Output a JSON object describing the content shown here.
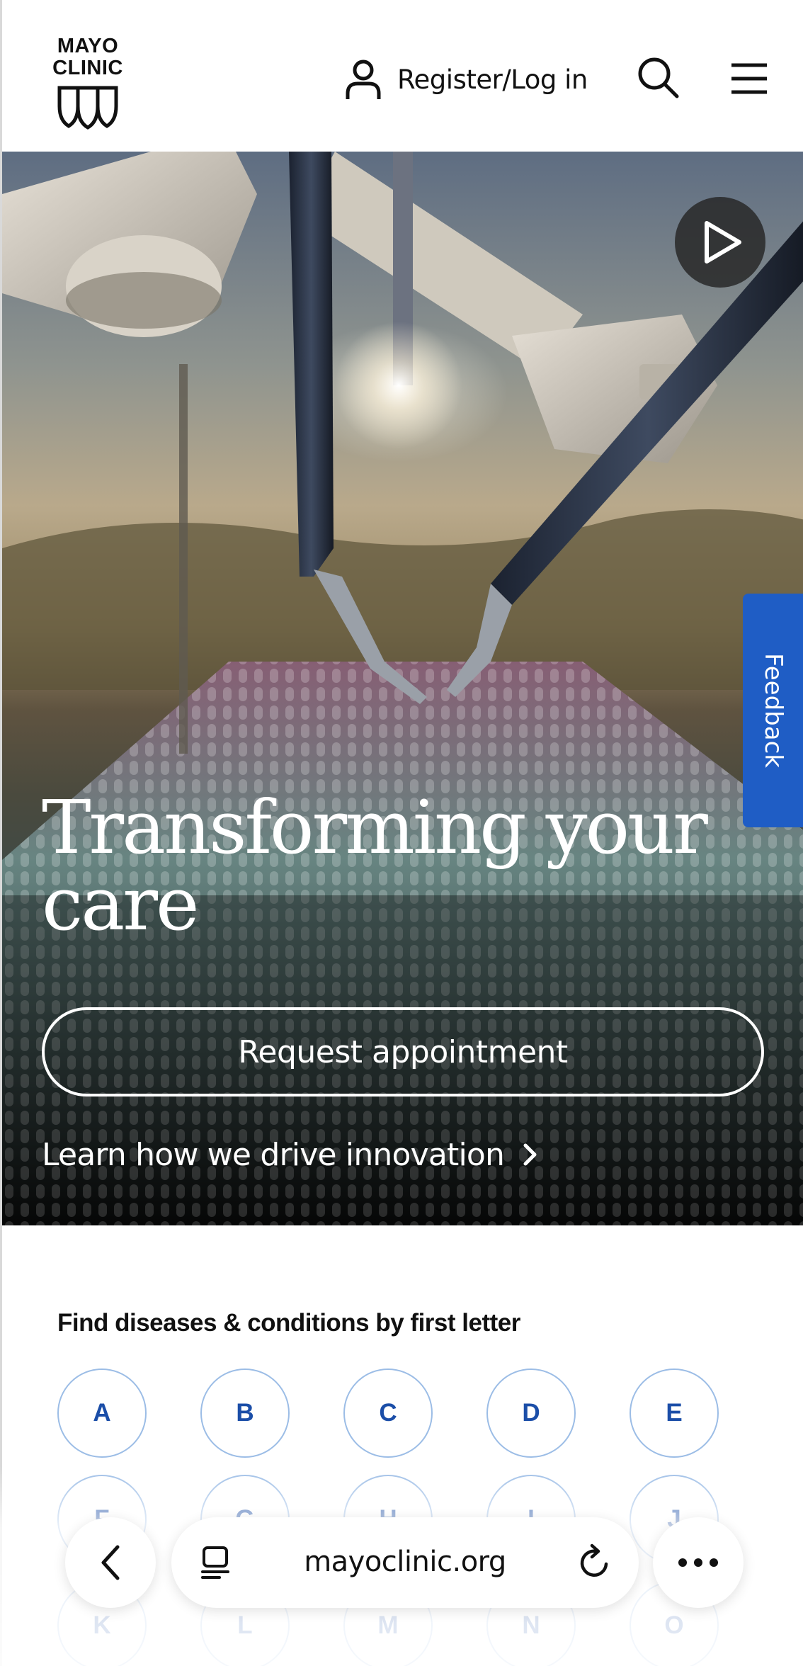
{
  "header": {
    "logo_line1": "MAYO",
    "logo_line2": "CLINIC",
    "login_label": "Register/Log in",
    "icons": [
      "user-icon",
      "search-icon",
      "menu-icon"
    ]
  },
  "hero": {
    "title": "Transforming your care",
    "cta_label": "Request appointment",
    "link_label": "Learn how we drive innovation",
    "icons": [
      "play-icon",
      "chevron-right-icon"
    ]
  },
  "feedback": {
    "label": "Feedback"
  },
  "az": {
    "heading": "Find diseases & conditions by first letter",
    "letters": [
      "A",
      "B",
      "C",
      "D",
      "E",
      "F",
      "G",
      "H",
      "I",
      "J",
      "K",
      "L",
      "M",
      "N",
      "O"
    ]
  },
  "browser": {
    "url": "mayoclinic.org",
    "icons": [
      "back-icon",
      "tabs-icon",
      "reload-icon",
      "more-icon"
    ]
  },
  "colors": {
    "brand_blue": "#1f5dc5",
    "letter_text": "#1b4ea8",
    "letter_border": "#9cbde6",
    "text_dark": "#111111",
    "white": "#ffffff"
  }
}
